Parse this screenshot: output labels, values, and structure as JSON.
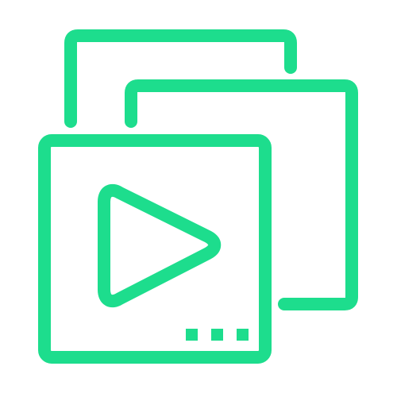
{
  "icon": {
    "name": "video-gallery-icon",
    "accent_color": "#1ddd8d",
    "background_color": "#ffffff",
    "layers": [
      {
        "name": "back-frame-icon"
      },
      {
        "name": "middle-frame-icon"
      },
      {
        "name": "front-frame-icon"
      }
    ],
    "symbols": {
      "play": "play-icon",
      "more": "more-dots-icon",
      "more_count": 3
    }
  }
}
